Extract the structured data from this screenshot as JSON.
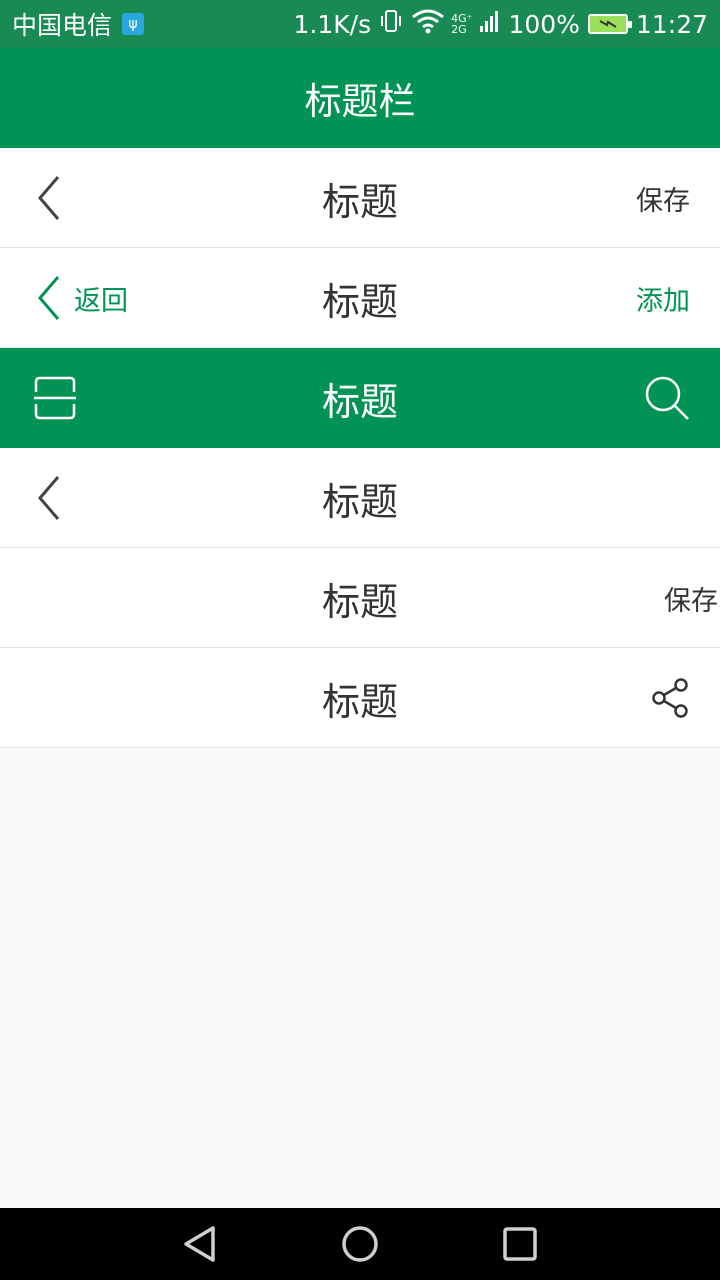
{
  "status_bar": {
    "carrier": "中国电信",
    "speed": "1.1K/s",
    "net_top": "4G⁺",
    "net_bottom": "2G",
    "battery": "100%",
    "time": "11:27"
  },
  "title_bar": {
    "title": "标题栏"
  },
  "rows": [
    {
      "title": "标题",
      "right": "保存"
    },
    {
      "title": "标题",
      "back_label": "返回",
      "right": "添加"
    },
    {
      "title": "标题"
    },
    {
      "title": "标题"
    },
    {
      "title": "标题",
      "right": "保存"
    },
    {
      "title": "标题"
    }
  ],
  "icons": {
    "back": "chevron-left-icon",
    "scan": "scan-icon",
    "search": "search-icon",
    "share": "share-icon",
    "nav_back": "triangle-back-icon",
    "nav_home": "circle-home-icon",
    "nav_recent": "square-recent-icon"
  },
  "colors": {
    "brand_green": "#009355",
    "status_green": "#1a8a55",
    "text_dark": "#333333",
    "background": "#f9f9f9"
  }
}
